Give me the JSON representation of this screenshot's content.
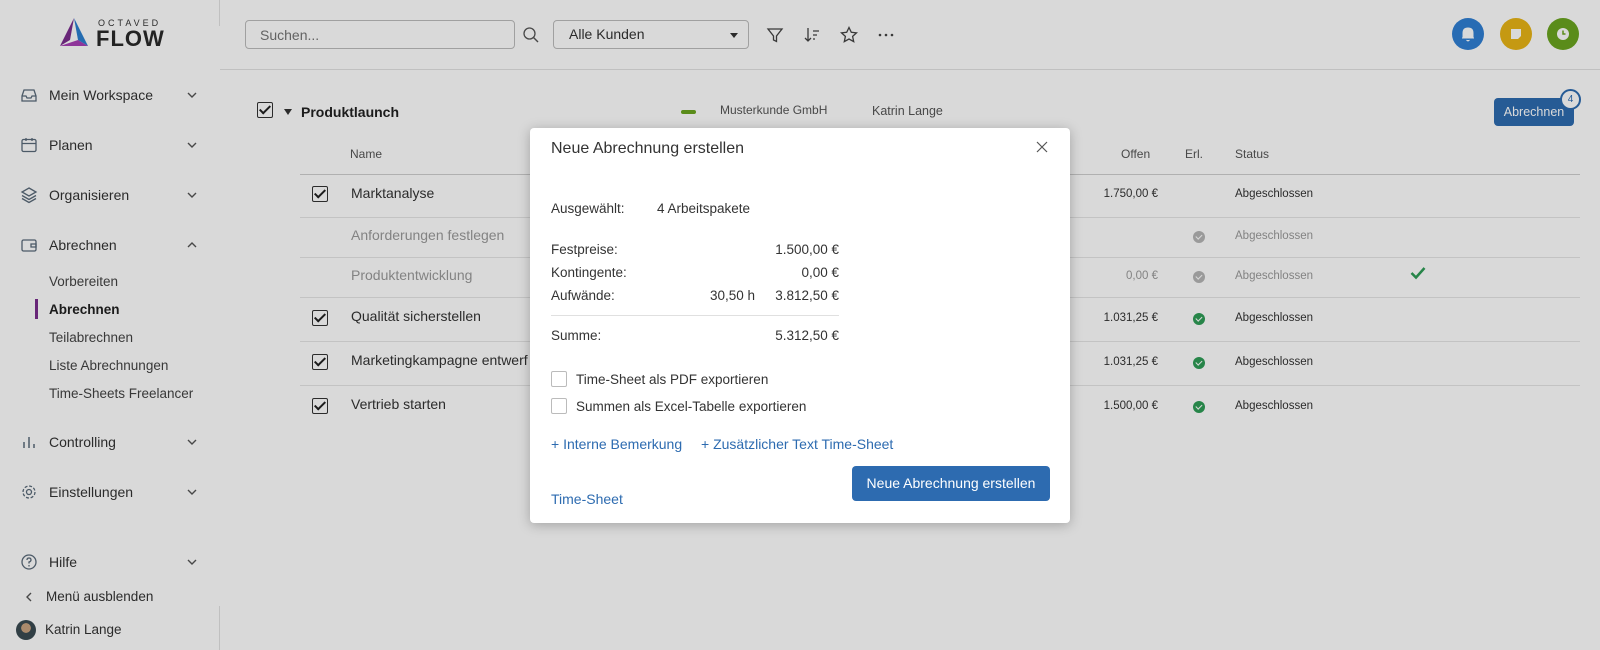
{
  "app": {
    "logo_sup": "OCTAVED",
    "logo_main": "FLOW"
  },
  "sidebar": {
    "items": [
      {
        "label": "Mein Workspace"
      },
      {
        "label": "Planen"
      },
      {
        "label": "Organisieren"
      },
      {
        "label": "Abrechnen"
      },
      {
        "label": "Controlling"
      },
      {
        "label": "Einstellungen"
      }
    ],
    "subitems": [
      {
        "label": "Vorbereiten"
      },
      {
        "label": "Abrechnen"
      },
      {
        "label": "Teilabrechnen"
      },
      {
        "label": "Liste Abrechnungen"
      },
      {
        "label": "Time-Sheets Freelancer"
      }
    ],
    "help": "Hilfe",
    "hide_menu": "Menü ausblenden",
    "user": "Katrin Lange"
  },
  "topbar": {
    "search_placeholder": "Suchen...",
    "customer_select": "Alle Kunden"
  },
  "colors": {
    "accent": "#2d6bb0",
    "active_marker": "#7b2d8e",
    "notify": "#2f7fd4",
    "notes": "#e8b416",
    "timer": "#6aa51f",
    "status_ok": "#2e9d56",
    "status_neutral": "#b5b5b5",
    "group_marker": "#6aa51f"
  },
  "group": {
    "name": "Produktlaunch",
    "customer": "Musterkunde GmbH",
    "owner": "Katrin Lange",
    "action": "Abrechnen",
    "badge": "4"
  },
  "table": {
    "columns": {
      "name": "Name",
      "open": "Offen",
      "done": "Erl.",
      "status": "Status"
    },
    "rows": [
      {
        "name": "Marktanalyse",
        "open": "1.750,00 €",
        "status": "Abgeschlossen"
      },
      {
        "name": "Anforderungen festlegen",
        "open": "",
        "status": "Abgeschlossen"
      },
      {
        "name": "Produktentwicklung",
        "open": "0,00 €",
        "status": "Abgeschlossen"
      },
      {
        "name": "Qualität sicherstellen",
        "open": "1.031,25 €",
        "status": "Abgeschlossen"
      },
      {
        "name": "Marketingkampagne entwerf",
        "open": "1.031,25 €",
        "status": "Abgeschlossen"
      },
      {
        "name": "Vertrieb starten",
        "open": "1.500,00 €",
        "status": "Abgeschlossen"
      }
    ]
  },
  "modal": {
    "title": "Neue Abrechnung erstellen",
    "selected_label": "Ausgewählt:",
    "selected_value": "4 Arbeitspakete",
    "fixed_label": "Festpreise:",
    "fixed_value": "1.500,00 €",
    "quota_label": "Kontingente:",
    "quota_value": "0,00 €",
    "effort_label": "Aufwände:",
    "effort_hours": "30,50 h",
    "effort_value": "3.812,50 €",
    "sum_label": "Summe:",
    "sum_value": "5.312,50 €",
    "opt_pdf": "Time-Sheet als PDF exportieren",
    "opt_excel": "Summen als Excel-Tabelle exportieren",
    "link_internal": "+ Interne Bemerkung",
    "link_extra": "+ Zusätzlicher Text Time-Sheet",
    "link_timesheet": "Time-Sheet",
    "submit": "Neue Abrechnung erstellen"
  }
}
